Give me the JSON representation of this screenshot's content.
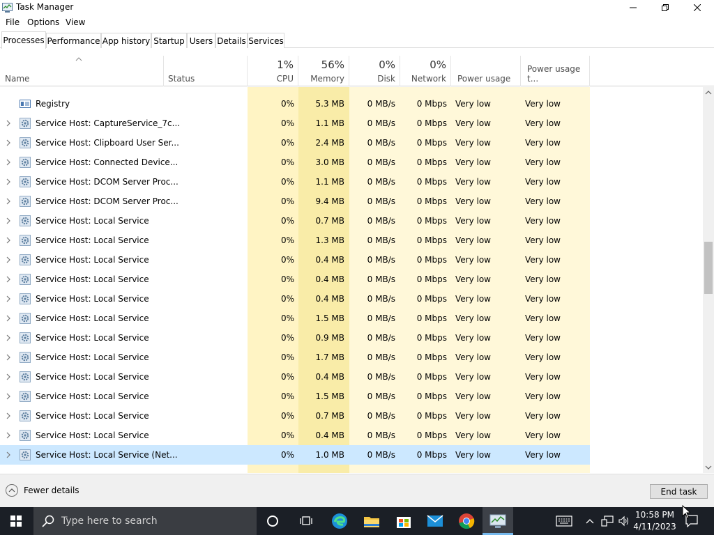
{
  "window": {
    "title": "Task Manager"
  },
  "menu": [
    "File",
    "Options",
    "View"
  ],
  "tabs": [
    "Processes",
    "Performance",
    "App history",
    "Startup",
    "Users",
    "Details",
    "Services"
  ],
  "columns": {
    "name": "Name",
    "status": "Status",
    "cpu": {
      "pct": "1%",
      "label": "CPU"
    },
    "memory": {
      "pct": "56%",
      "label": "Memory"
    },
    "disk": {
      "pct": "0%",
      "label": "Disk"
    },
    "network": {
      "pct": "0%",
      "label": "Network"
    },
    "power": "Power usage",
    "power_trend": "Power usage t..."
  },
  "rows": [
    {
      "name": "Registry",
      "cpu": "0%",
      "memory": "5.3 MB",
      "disk": "0 MB/s",
      "network": "0 Mbps",
      "power": "Very low",
      "trend": "Very low",
      "expand": false,
      "icon": "registry-icon"
    },
    {
      "name": "Service Host: CaptureService_7c...",
      "cpu": "0%",
      "memory": "1.1 MB",
      "disk": "0 MB/s",
      "network": "0 Mbps",
      "power": "Very low",
      "trend": "Very low",
      "expand": true,
      "icon": "gear-icon"
    },
    {
      "name": "Service Host: Clipboard User Ser...",
      "cpu": "0%",
      "memory": "2.4 MB",
      "disk": "0 MB/s",
      "network": "0 Mbps",
      "power": "Very low",
      "trend": "Very low",
      "expand": true,
      "icon": "gear-icon"
    },
    {
      "name": "Service Host: Connected Device...",
      "cpu": "0%",
      "memory": "3.0 MB",
      "disk": "0 MB/s",
      "network": "0 Mbps",
      "power": "Very low",
      "trend": "Very low",
      "expand": true,
      "icon": "gear-icon"
    },
    {
      "name": "Service Host: DCOM Server Proc...",
      "cpu": "0%",
      "memory": "1.1 MB",
      "disk": "0 MB/s",
      "network": "0 Mbps",
      "power": "Very low",
      "trend": "Very low",
      "expand": true,
      "icon": "gear-icon"
    },
    {
      "name": "Service Host: DCOM Server Proc...",
      "cpu": "0%",
      "memory": "9.4 MB",
      "disk": "0 MB/s",
      "network": "0 Mbps",
      "power": "Very low",
      "trend": "Very low",
      "expand": true,
      "icon": "gear-icon"
    },
    {
      "name": "Service Host: Local Service",
      "cpu": "0%",
      "memory": "0.7 MB",
      "disk": "0 MB/s",
      "network": "0 Mbps",
      "power": "Very low",
      "trend": "Very low",
      "expand": true,
      "icon": "gear-icon"
    },
    {
      "name": "Service Host: Local Service",
      "cpu": "0%",
      "memory": "1.3 MB",
      "disk": "0 MB/s",
      "network": "0 Mbps",
      "power": "Very low",
      "trend": "Very low",
      "expand": true,
      "icon": "gear-icon"
    },
    {
      "name": "Service Host: Local Service",
      "cpu": "0%",
      "memory": "0.4 MB",
      "disk": "0 MB/s",
      "network": "0 Mbps",
      "power": "Very low",
      "trend": "Very low",
      "expand": true,
      "icon": "gear-icon"
    },
    {
      "name": "Service Host: Local Service",
      "cpu": "0%",
      "memory": "0.4 MB",
      "disk": "0 MB/s",
      "network": "0 Mbps",
      "power": "Very low",
      "trend": "Very low",
      "expand": true,
      "icon": "gear-icon"
    },
    {
      "name": "Service Host: Local Service",
      "cpu": "0%",
      "memory": "0.4 MB",
      "disk": "0 MB/s",
      "network": "0 Mbps",
      "power": "Very low",
      "trend": "Very low",
      "expand": true,
      "icon": "gear-icon"
    },
    {
      "name": "Service Host: Local Service",
      "cpu": "0%",
      "memory": "1.5 MB",
      "disk": "0 MB/s",
      "network": "0 Mbps",
      "power": "Very low",
      "trend": "Very low",
      "expand": true,
      "icon": "gear-icon"
    },
    {
      "name": "Service Host: Local Service",
      "cpu": "0%",
      "memory": "0.9 MB",
      "disk": "0 MB/s",
      "network": "0 Mbps",
      "power": "Very low",
      "trend": "Very low",
      "expand": true,
      "icon": "gear-icon"
    },
    {
      "name": "Service Host: Local Service",
      "cpu": "0%",
      "memory": "1.7 MB",
      "disk": "0 MB/s",
      "network": "0 Mbps",
      "power": "Very low",
      "trend": "Very low",
      "expand": true,
      "icon": "gear-icon"
    },
    {
      "name": "Service Host: Local Service",
      "cpu": "0%",
      "memory": "0.4 MB",
      "disk": "0 MB/s",
      "network": "0 Mbps",
      "power": "Very low",
      "trend": "Very low",
      "expand": true,
      "icon": "gear-icon"
    },
    {
      "name": "Service Host: Local Service",
      "cpu": "0%",
      "memory": "1.5 MB",
      "disk": "0 MB/s",
      "network": "0 Mbps",
      "power": "Very low",
      "trend": "Very low",
      "expand": true,
      "icon": "gear-icon"
    },
    {
      "name": "Service Host: Local Service",
      "cpu": "0%",
      "memory": "0.7 MB",
      "disk": "0 MB/s",
      "network": "0 Mbps",
      "power": "Very low",
      "trend": "Very low",
      "expand": true,
      "icon": "gear-icon"
    },
    {
      "name": "Service Host: Local Service",
      "cpu": "0%",
      "memory": "0.4 MB",
      "disk": "0 MB/s",
      "network": "0 Mbps",
      "power": "Very low",
      "trend": "Very low",
      "expand": true,
      "icon": "gear-icon"
    },
    {
      "name": "Service Host: Local Service (Net...",
      "cpu": "0%",
      "memory": "1.0 MB",
      "disk": "0 MB/s",
      "network": "0 Mbps",
      "power": "Very low",
      "trend": "Very low",
      "expand": true,
      "icon": "gear-icon",
      "selected": true
    }
  ],
  "footer": {
    "fewer_details": "Fewer details",
    "end_task": "End task"
  },
  "taskbar": {
    "search_placeholder": "Type here to search",
    "time": "10:58 PM",
    "date": "4/11/2023"
  },
  "colors": {
    "cpu_col": "#fff4c4",
    "memory_col": "#f9eca8",
    "light_col": "#fff8d9",
    "selected_row": "#cce8ff",
    "taskbar": "#1b1f26",
    "accent": "#0078d7"
  }
}
